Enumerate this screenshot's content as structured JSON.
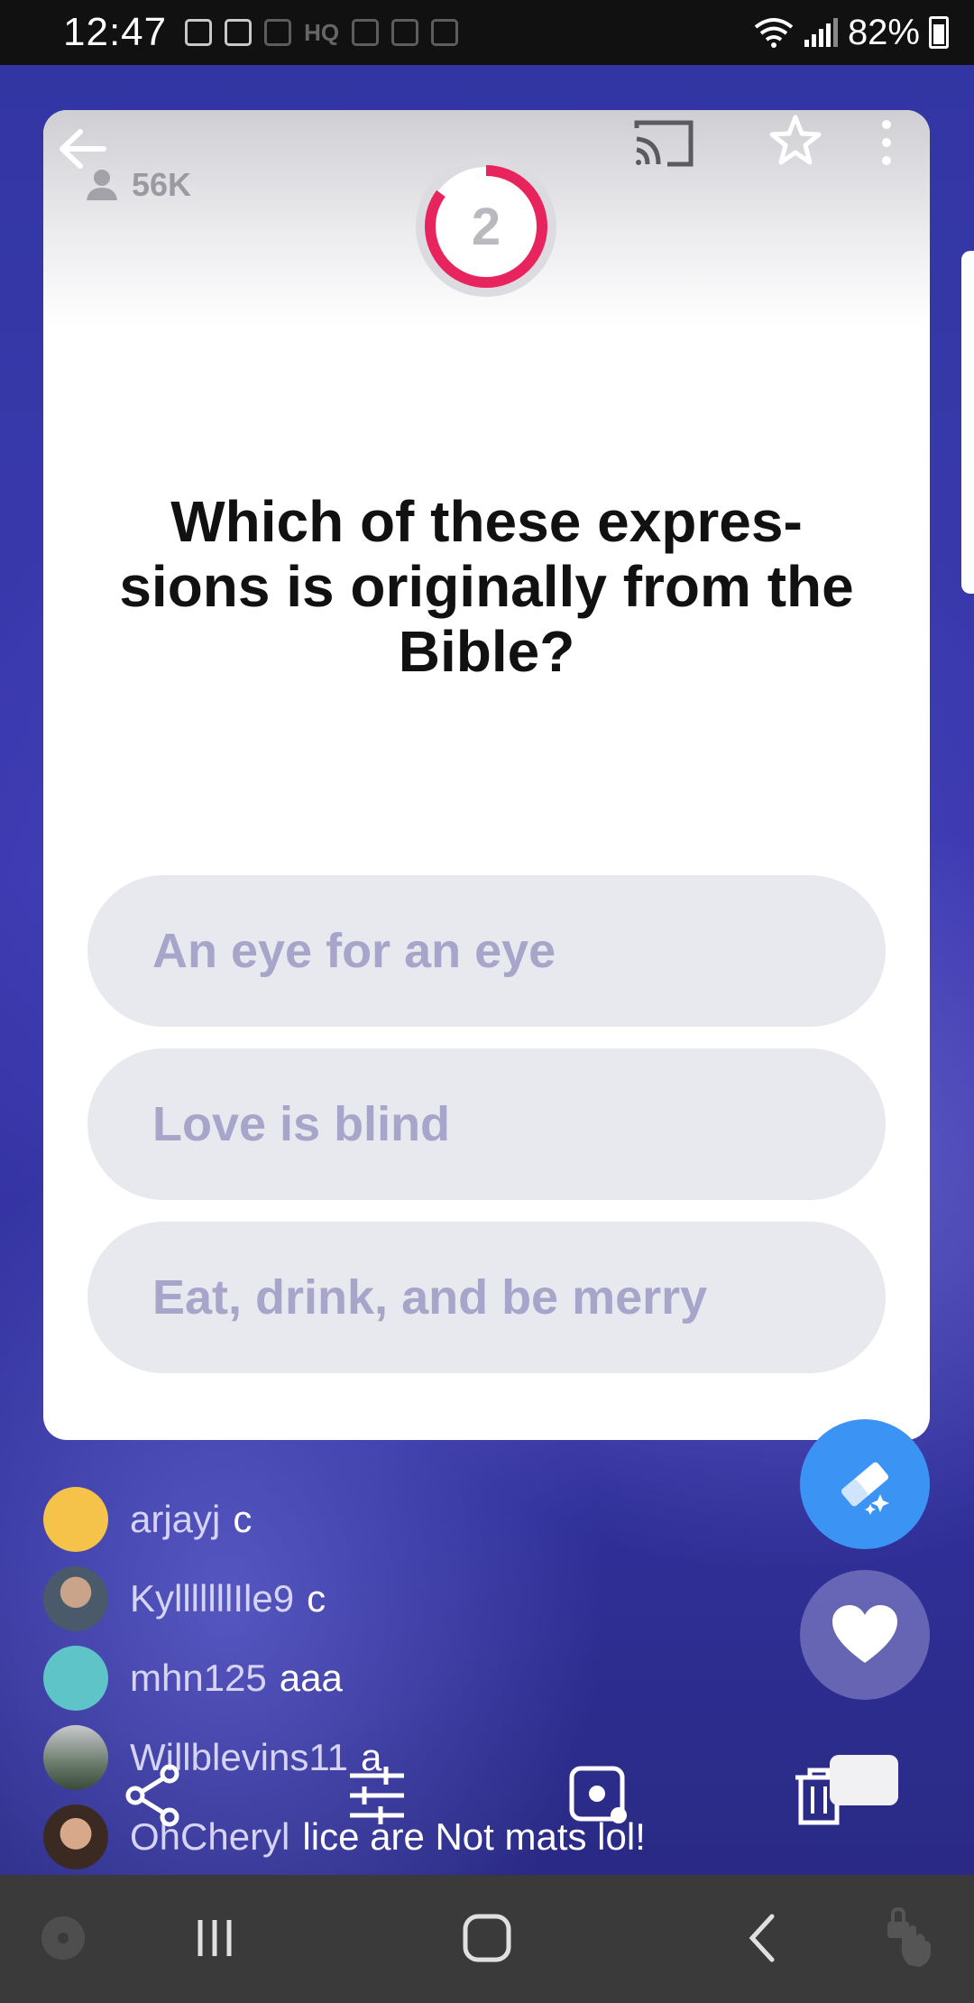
{
  "status_bar": {
    "time": "12:47",
    "notification_icons": [
      "news-icon",
      "discord-icon",
      "discord-icon",
      "hq-icon",
      "shopping-bag-icon",
      "shopping-bag-icon",
      "shopping-bag-icon"
    ],
    "hq_label": "HQ",
    "battery": "82%",
    "icons": [
      "wifi-icon",
      "signal-icon",
      "battery-icon"
    ]
  },
  "card": {
    "viewer_count": "56K",
    "timer_value": "2",
    "timer_fraction_remaining": 0.85,
    "question": "Which of these expres-sions is originally from the Bible?",
    "question_lines": [
      "Which of these expres-",
      "sions is originally from the",
      "Bible?"
    ],
    "answers": [
      {
        "label": "An eye for an eye"
      },
      {
        "label": "Love is blind"
      },
      {
        "label": "Eat, drink, and be merry"
      }
    ]
  },
  "comments": [
    {
      "user": "arjayj",
      "text": "c",
      "avatar_color": "#f5c24a"
    },
    {
      "user": "KylllllllIle9",
      "text": "c",
      "avatar_color": "#8a7a70"
    },
    {
      "user": "mhn125",
      "text": "aaa",
      "avatar_color": "#5fc4c7"
    },
    {
      "user": "Willblevins11",
      "text": "a",
      "avatar_color": "#5a6a5a"
    },
    {
      "user": "OhCheryl",
      "text": "lice are Not mats lol!",
      "avatar_color": "#7a4a3a"
    }
  ],
  "colors": {
    "accent_blue": "#3b93f3",
    "timer_ring": "#e8245e",
    "answer_bg": "#e8e8ef",
    "answer_text": "#a7a5c9",
    "background": "#3236a3"
  }
}
